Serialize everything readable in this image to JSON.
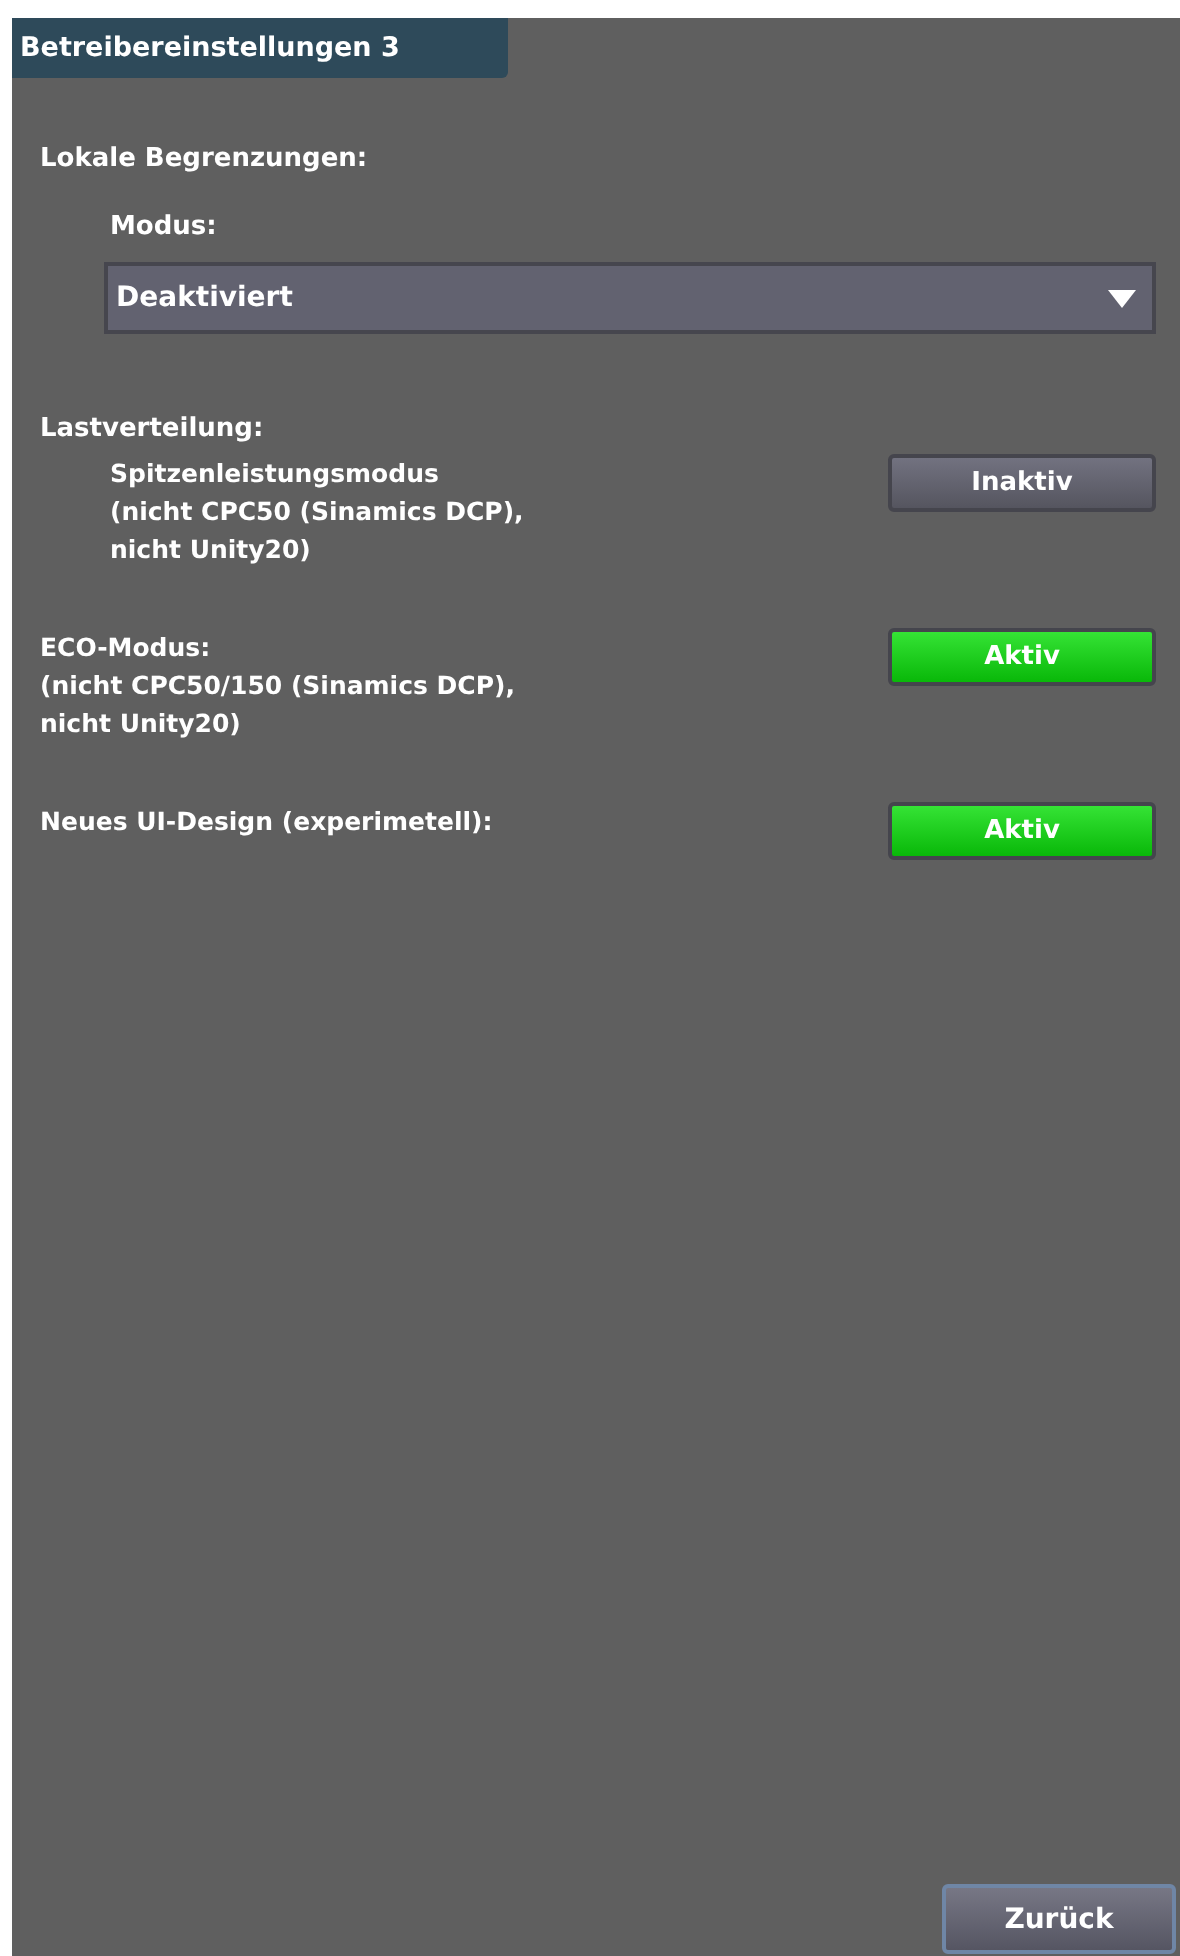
{
  "panel": {
    "title": "Betreibereinstellungen 3"
  },
  "local_limits": {
    "heading": "Lokale Begrenzungen:",
    "mode_label": "Modus:",
    "mode_dropdown": {
      "value": "Deaktiviert"
    }
  },
  "load_sharing": {
    "heading": "Lastverteilung:"
  },
  "settings": [
    {
      "label": "Spitzenleistungsmodus\n(nicht CPC50 (Sinamics DCP),\nnicht Unity20)",
      "indented": true,
      "button": "Inaktiv",
      "on": false
    },
    {
      "label": "ECO-Modus:\n(nicht CPC50/150 (Sinamics DCP),\nnicht Unity20)",
      "indented": false,
      "button": "Aktiv",
      "on": true
    },
    {
      "label": "Neues UI-Design (experimetell):",
      "indented": false,
      "button": "Aktiv",
      "on": true
    }
  ],
  "back_button": "Zurück"
}
